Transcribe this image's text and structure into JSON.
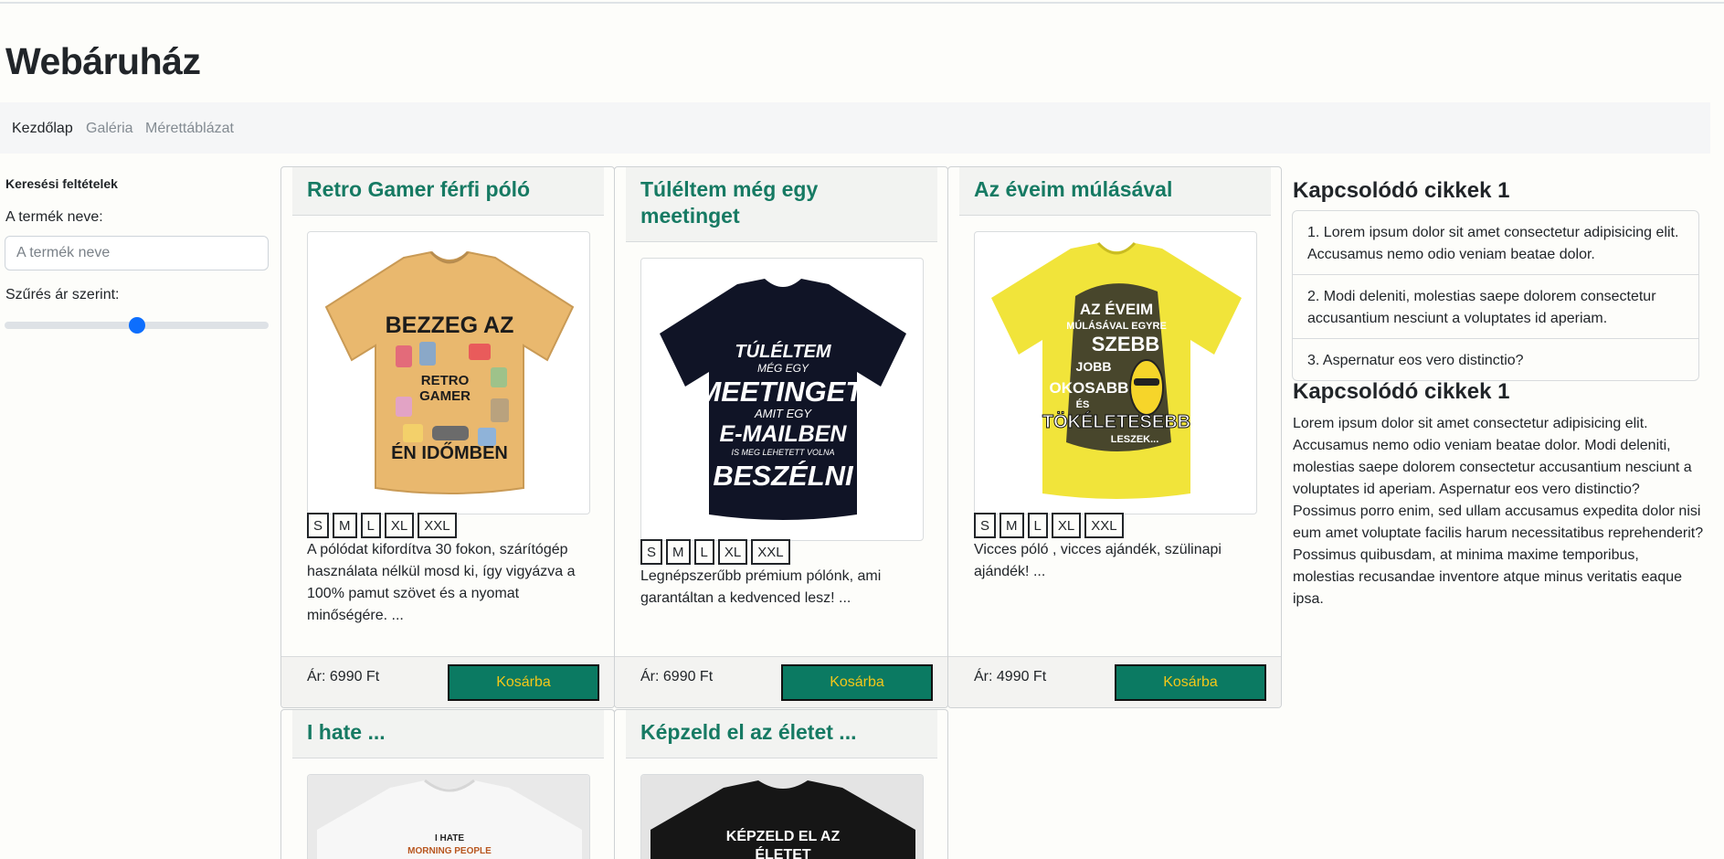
{
  "site": {
    "title": "Webáruház"
  },
  "nav": {
    "items": [
      "Kezdőlap",
      "Galéria",
      "Mérettáblázat"
    ]
  },
  "filters": {
    "heading": "Keresési feltételek",
    "name_label": "A termék neve:",
    "name_placeholder": "A termék neve",
    "name_value": "",
    "price_label": "Szűrés ár szerint:",
    "price_slider_value": 0.5
  },
  "products": [
    {
      "title": "Retro Gamer férfi póló",
      "shirt_color": "#e9b86e",
      "print_lines": [
        "BEZZEG AZ",
        "RETRO",
        "GAMER",
        "ÉN IDŐMBEN"
      ],
      "sizes": [
        "S",
        "M",
        "L",
        "XL",
        "XXL"
      ],
      "description": "A pólódat kifordítva 30 fokon, szárítógép használata nélkül mosd ki, így vigyázva a 100% pamut szövet és a nyomat minőségére. ...",
      "price": "Ár: 6990 Ft",
      "button": "Kosárba"
    },
    {
      "title": "Túléltem még egy meetinget",
      "shirt_color": "#101426",
      "print_lines": [
        "TÚLÉLTEM",
        "MÉG EGY",
        "MEETINGET,",
        "AMIT EGY",
        "E-MAILBEN",
        "IS MEG LEHETETT VOLNA",
        "BESZÉLNI"
      ],
      "sizes": [
        "S",
        "M",
        "L",
        "XL",
        "XXL"
      ],
      "description": "Legnépszerűbb prémium pólónk, ami garantáltan a kedvenced lesz! ...",
      "price": "Ár: 6990 Ft",
      "button": "Kosárba"
    },
    {
      "title": "Az éveim múlásával",
      "shirt_color": "#f1e43a",
      "print_lines": [
        "AZ ÉVEIM",
        "MÚLÁSÁVAL EGYRE",
        "SZEBB",
        "JOBB",
        "OKOSABB",
        "ÉS",
        "TÖKÉLETESEBB",
        "LESZEK..."
      ],
      "sizes": [
        "S",
        "M",
        "L",
        "XL",
        "XXL"
      ],
      "description": "Vicces póló , vicces ajándék, szülinapi ajándék! ...",
      "price": "Ár: 4990 Ft",
      "button": "Kosárba"
    },
    {
      "title": "I hate ...",
      "shirt_color": "#f7f7f7",
      "print_lines": [
        "I HATE",
        "MORNING PEOPLE"
      ]
    },
    {
      "title": "Képzeld el az életet ...",
      "shirt_color": "#161616",
      "print_lines": [
        "KÉPZELD EL AZ",
        "ÉLETET"
      ]
    }
  ],
  "sidebar": {
    "heading1": "Kapcsolódó cikkek 1",
    "articles": [
      "1. Lorem ipsum dolor sit amet consectetur adipisicing elit. Accusamus nemo odio veniam beatae dolor.",
      "2. Modi deleniti, molestias saepe dolorem consectetur accusantium nesciunt a voluptates id aperiam.",
      "3. Aspernatur eos vero distinctio?"
    ],
    "heading2": "Kapcsolódó cikkek 1",
    "paragraph": "Lorem ipsum dolor sit amet consectetur adipisicing elit. Accusamus nemo odio veniam beatae dolor. Modi deleniti, molestias saepe dolorem consectetur accusantium nesciunt a voluptates id aperiam. Aspernatur eos vero distinctio? Possimus porro enim, sed ullam accusamus expedita dolor nisi eum amet voluptate facilis harum necessitatibus reprehenderit? Possimus quibusdam, at minima maxime temporibus, molestias recusandae inventore atque minus veritatis eaque ipsa."
  }
}
